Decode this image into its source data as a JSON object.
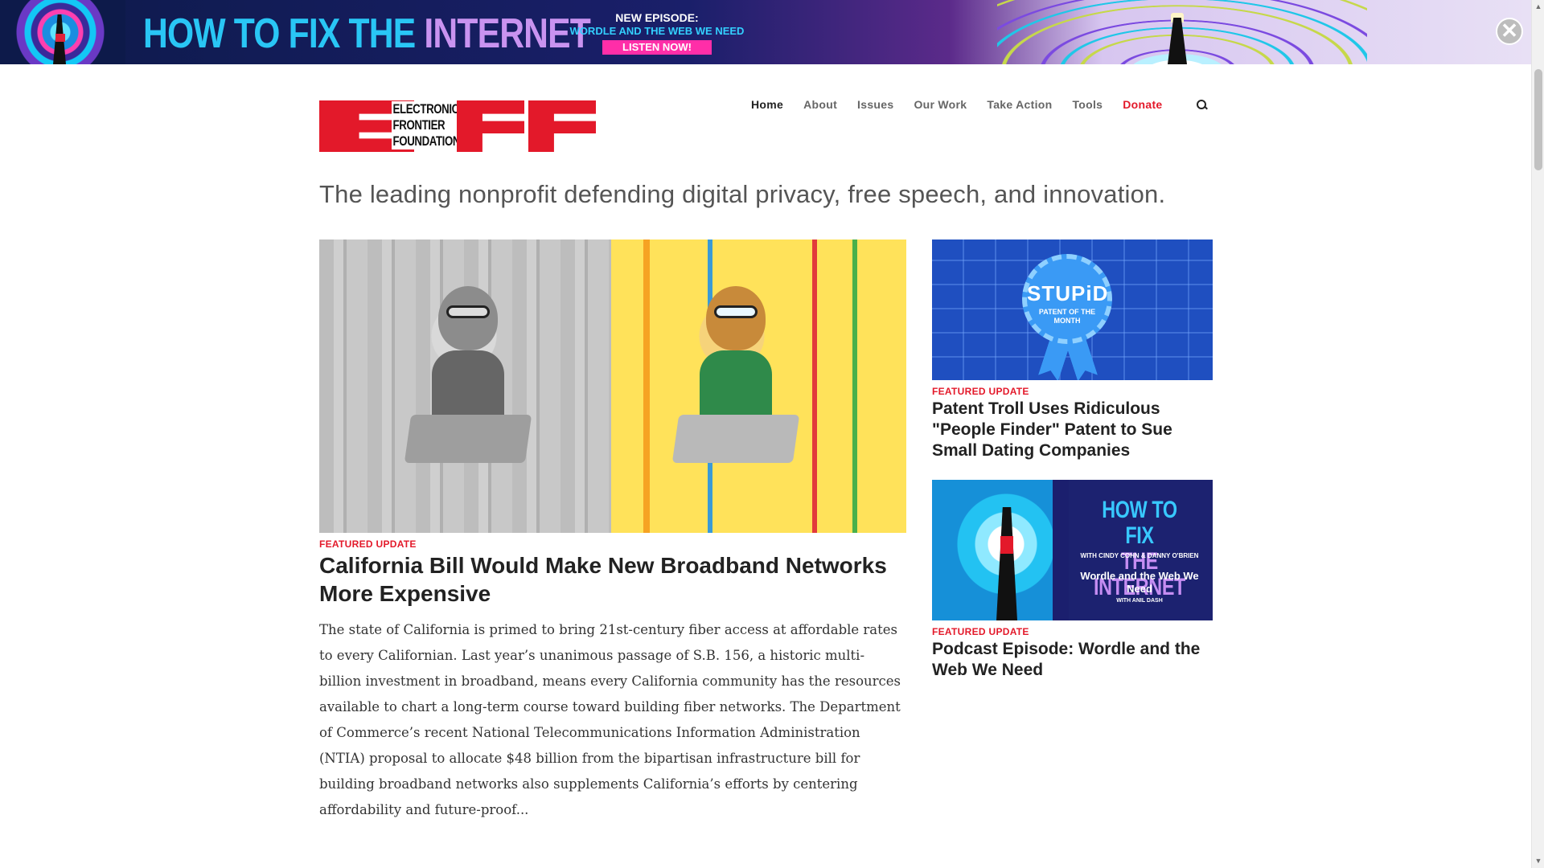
{
  "banner": {
    "title_part1": "HOW TO FIX THE",
    "title_part2": "INTERNET",
    "promo_line1": "NEW EPISODE:",
    "promo_line2": "WORDLE AND THE WEB WE NEED",
    "promo_button": "LISTEN NOW!",
    "close_symbol": "✕"
  },
  "logo": {
    "text_line1": "ELECTRONIC",
    "text_line2": "FRONTIER",
    "text_line3": "FOUNDATION"
  },
  "nav": {
    "items": [
      {
        "label": "Home"
      },
      {
        "label": "About"
      },
      {
        "label": "Issues"
      },
      {
        "label": "Our Work"
      },
      {
        "label": "Take Action"
      },
      {
        "label": "Tools"
      },
      {
        "label": "Donate"
      }
    ]
  },
  "tagline": "The leading nonprofit defending digital privacy, free speech, and innovation.",
  "feature": {
    "label": "FEATURED UPDATE",
    "title": "California Bill Would Make New Broadband Networks More Expensive",
    "body": "The state of California is primed to bring 21st-century fiber access at affordable rates to every Californian. Last year’s unanimous passage of S.B. 156, a historic multi-billion investment in broadband, means every California community has the resources available to chart a long-term course toward building fiber networks. The Department of Commerce’s recent National Telecommunications Information Administration (NTIA) proposal to allocate $48 billion from the bipartisan infrastructure bill for building broadband networks also supplements California’s efforts by centering affordability and future-proof..."
  },
  "sidebar": {
    "cards": [
      {
        "image_title": "STUPiD",
        "image_subtitle": "PATENT OF THE MONTH",
        "label": "FEATURED UPDATE",
        "title": "Patent Troll Uses Ridiculous \"People Finder\" Patent to Sue Small Dating Companies"
      },
      {
        "image_title_line1": "HOW TO FIX",
        "image_title_line2": "THE INTERNET",
        "image_hosts": "WITH CINDY COHN & DANNY O'BRIEN",
        "image_episode": "Wordle and the Web We Need",
        "image_guest": "WITH ANIL DASH",
        "label": "FEATURED UPDATE",
        "title": "Podcast Episode: Wordle and the Web We Need"
      }
    ]
  },
  "colors": {
    "brand_red": "#e3192a",
    "text_dark": "#222222",
    "nav_gray": "#666666"
  }
}
